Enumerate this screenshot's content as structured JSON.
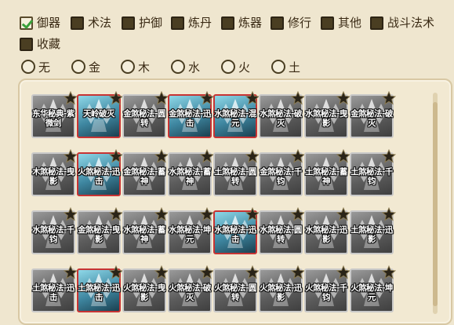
{
  "categories": [
    {
      "label": "御器",
      "checked": true
    },
    {
      "label": "术法",
      "checked": false
    },
    {
      "label": "护御",
      "checked": false
    },
    {
      "label": "炼丹",
      "checked": false
    },
    {
      "label": "炼器",
      "checked": false
    },
    {
      "label": "修行",
      "checked": false
    },
    {
      "label": "其他",
      "checked": false
    },
    {
      "label": "战斗法术",
      "checked": false
    },
    {
      "label": "收藏",
      "checked": false
    }
  ],
  "elements": [
    {
      "label": "无"
    },
    {
      "label": "金"
    },
    {
      "label": "木"
    },
    {
      "label": "水"
    },
    {
      "label": "火"
    },
    {
      "label": "土"
    }
  ],
  "skills": [
    {
      "name": "东华秘典-紫微剑",
      "active": false
    },
    {
      "name": "天岭破灭",
      "active": true
    },
    {
      "name": "金煞秘法-圆转",
      "active": false
    },
    {
      "name": "金煞秘法-迅击",
      "active": true
    },
    {
      "name": "水煞秘法-混元",
      "active": true
    },
    {
      "name": "水煞秘法-破灭",
      "active": false
    },
    {
      "name": "水煞秘法-曳影",
      "active": false
    },
    {
      "name": "金煞秘法-破灭",
      "active": false
    },
    {
      "name": "木煞秘法-曳影",
      "active": false
    },
    {
      "name": "火煞秘法-迅击",
      "active": true
    },
    {
      "name": "金煞秘法-蓄神",
      "active": false
    },
    {
      "name": "水煞秘法-蓄神",
      "active": false
    },
    {
      "name": "土煞秘法-圆转",
      "active": false
    },
    {
      "name": "金煞秘法-千钧",
      "active": false
    },
    {
      "name": "土煞秘法-蓄神",
      "active": false
    },
    {
      "name": "土煞秘法-千钧",
      "active": false
    },
    {
      "name": "水煞秘法-千钧",
      "active": false
    },
    {
      "name": "金煞秘法-曳影",
      "active": false
    },
    {
      "name": "水煞秘法-蓄神",
      "active": false
    },
    {
      "name": "水煞秘法-坤元",
      "active": false
    },
    {
      "name": "水煞秘法-迅击",
      "active": true
    },
    {
      "name": "水煞秘法-圆转",
      "active": false
    },
    {
      "name": "水煞秘法-迅影",
      "active": false
    },
    {
      "name": "土煞秘法-迅影",
      "active": false
    },
    {
      "name": "土煞秘法-迅击",
      "active": false
    },
    {
      "name": "土煞秘法-迅击",
      "active": true
    },
    {
      "name": "火煞秘法-曳影",
      "active": false
    },
    {
      "name": "火煞秘法-破灭",
      "active": false
    },
    {
      "name": "火煞秘法-圆转",
      "active": false
    },
    {
      "name": "火煞秘法-迅影",
      "active": false
    },
    {
      "name": "火煞秘法-千钧",
      "active": false
    },
    {
      "name": "火煞秘法-坤元",
      "active": false
    }
  ]
}
